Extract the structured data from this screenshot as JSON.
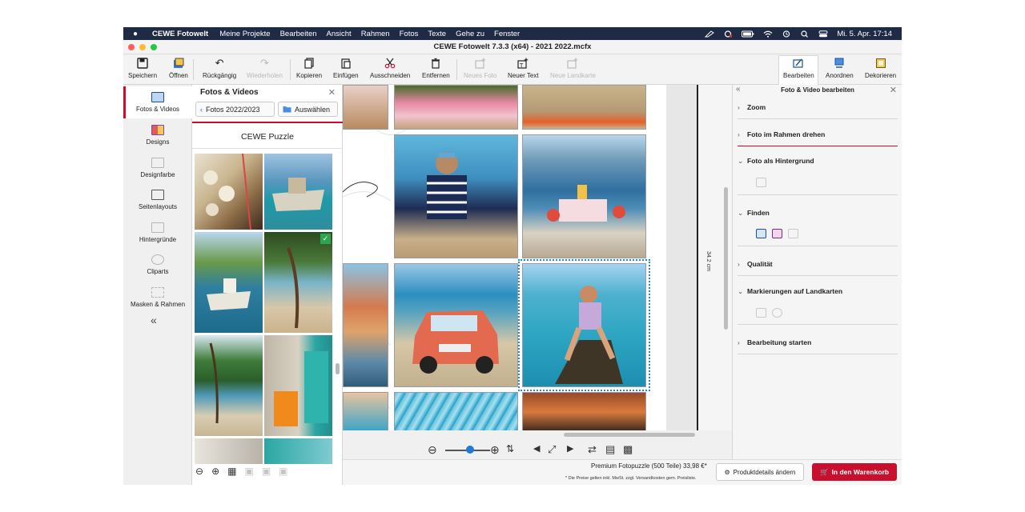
{
  "menubar": {
    "app": "CEWE Fotowelt",
    "items": [
      "Meine Projekte",
      "Bearbeiten",
      "Ansicht",
      "Rahmen",
      "Fotos",
      "Texte",
      "Gehe zu",
      "Fenster"
    ],
    "datetime": "Mi. 5. Apr.  17:14"
  },
  "window": {
    "title": "CEWE Fotowelt 7.3.3 (x64) - 2021  2022.mcfx"
  },
  "toolbar": {
    "speichern": "Speichern",
    "oeffnen": "Öffnen",
    "rueckgaengig": "Rückgängig",
    "wiederholen": "Wiederholen",
    "kopieren": "Kopieren",
    "einfuegen": "Einfügen",
    "ausschneiden": "Ausschneiden",
    "entfernen": "Entfernen",
    "neues_foto": "Neues Foto",
    "neuer_text": "Neuer Text",
    "neue_landkarte": "Neue Landkarte",
    "bearbeiten": "Bearbeiten",
    "anordnen": "Anordnen",
    "dekorieren": "Dekorieren"
  },
  "leftnav": {
    "items": [
      "Fotos & Videos",
      "Designs",
      "Designfarbe",
      "Seitenlayouts",
      "Hintergründe",
      "Cliparts",
      "Masken & Rahmen"
    ]
  },
  "media": {
    "title": "Fotos & Videos",
    "folder": "Fotos 2022/2023",
    "select": "Auswählen",
    "section": "CEWE Puzzle"
  },
  "canvas": {
    "dimension": "34.2 cm"
  },
  "footer": {
    "product": "Premium Fotopuzzle (500 Teile) 33,98 €*",
    "note": "* Die Preise gelten inkl. MwSt. zzgl. Versandkosten gem. Preisliste.",
    "details_button": "Produktdetails ändern",
    "cart_button": "In den Warenkorb"
  },
  "rightpanel": {
    "title": "Foto & Video bearbeiten",
    "sections": [
      "Zoom",
      "Foto im Rahmen drehen",
      "Foto als Hintergrund",
      "Finden",
      "Qualität",
      "Markierungen auf Landkarten",
      "Bearbeitung starten"
    ]
  },
  "colors": {
    "brand_red": "#c8102e",
    "selection_blue": "#1e8bdc",
    "menubar": "#1f2a44"
  }
}
